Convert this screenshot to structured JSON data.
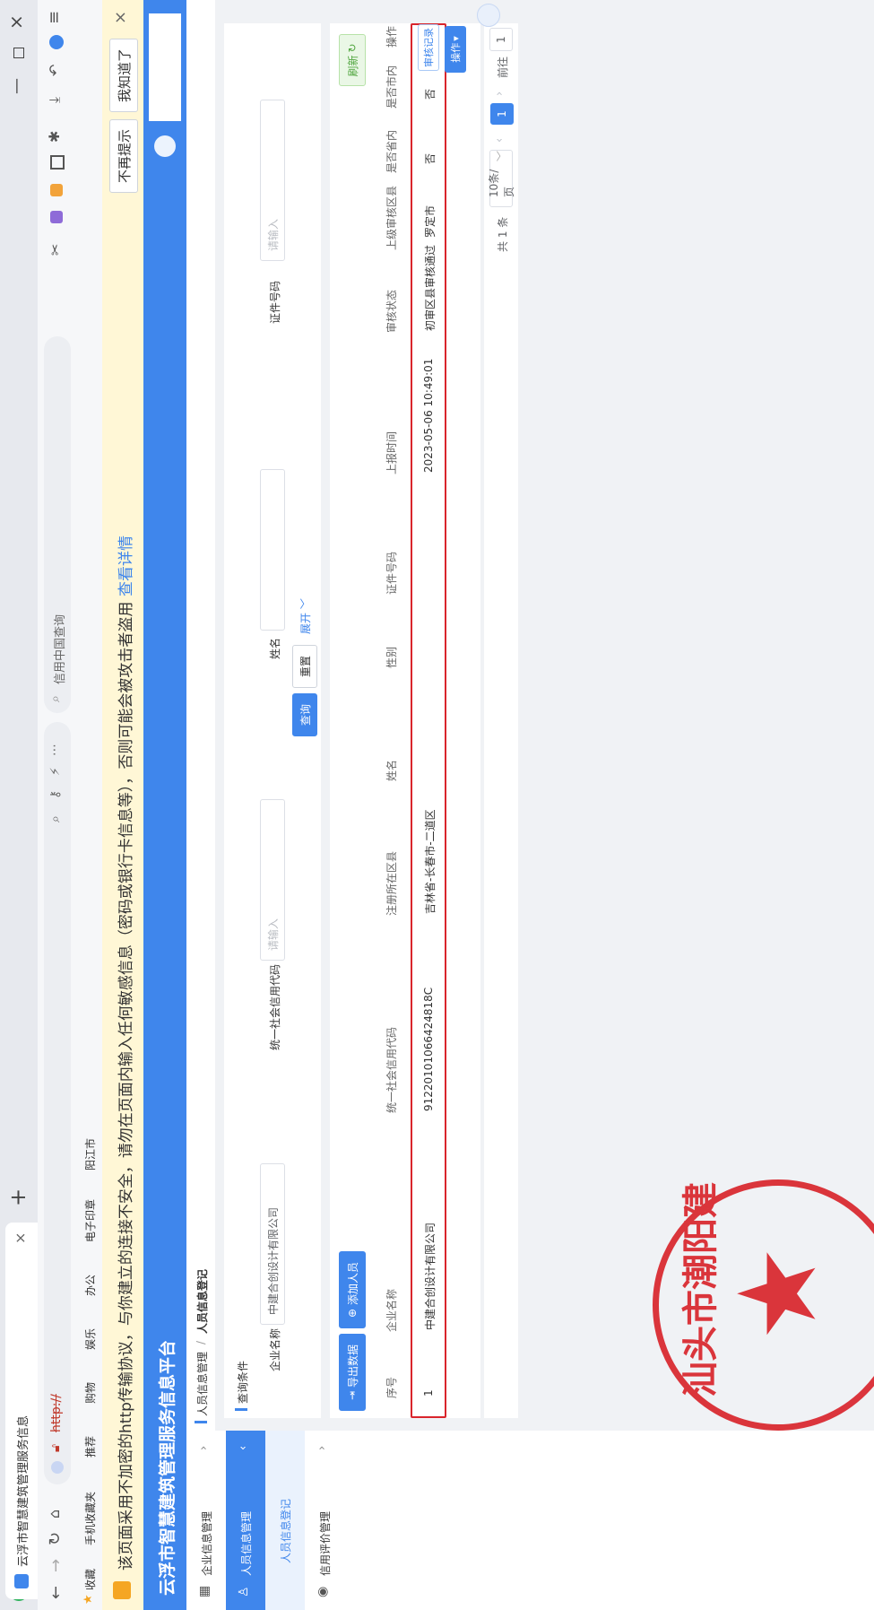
{
  "browser": {
    "tab_title": "云浮市智慧建筑管理服务信息",
    "new_tab_symbol": "+",
    "url": "http://",
    "search_placeholder": "信用中国查询",
    "colors": {
      "warning_bg": "#fff7d6",
      "header_blue": "#3f86ec",
      "seal_red": "#d9252c"
    }
  },
  "bookmarks": [
    "收藏",
    "手机收藏夹",
    "推荐",
    "购物",
    "娱乐",
    "办公",
    "电子印章",
    "阳江市"
  ],
  "warning": {
    "message": "该页面采用不加密的http传输协议，与你建立的连接不安全，请勿在页面内输入任何敏感信息（密码或银行卡信息等），否则可能会被攻击者盗用",
    "details_link": "查看详情",
    "dismiss_button": "不再提示",
    "ok_button": "我知道了",
    "close_symbol": "×"
  },
  "app": {
    "title": "云浮市智慧建筑管理服务信息平台"
  },
  "sidebar": {
    "items": [
      {
        "label": "企业信息管理"
      },
      {
        "label": "人员信息管理"
      },
      {
        "label": "人员信息登记"
      },
      {
        "label": "信用评价管理"
      }
    ]
  },
  "breadcrumb": {
    "parent": "人员信息管理",
    "separator": "/",
    "current": "人员信息登记"
  },
  "query": {
    "section_title": "查询条件",
    "company_label": "企业名称",
    "company_value": "中建合创设计有限公司",
    "uscc_label": "统一社会信用代码",
    "uscc_placeholder": "请输入",
    "name_label": "姓名",
    "name_value": "",
    "cert_label": "证件号码",
    "cert_placeholder": "请输入",
    "search_button": "查询",
    "reset_button": "重置",
    "expand_link": "展开"
  },
  "toolbar": {
    "export_button": "导出数据",
    "add_button": "添加人员",
    "refresh_button": "刷新"
  },
  "table": {
    "headers": [
      "序号",
      "企业名称",
      "统一社会信用代码",
      "注册所在区县",
      "姓名",
      "性别",
      "证件号码",
      "上报时间",
      "审核状态",
      "上级审核区县",
      "是否省内",
      "是否市内",
      "操作"
    ],
    "rows": [
      {
        "index": "1",
        "company": "中建合创设计有限公司",
        "uscc": "91220101066424818C",
        "district": "吉林省-长春市-二道区",
        "name": "",
        "gender": "",
        "cert": "",
        "report_time": "2023-05-06 10:49:01",
        "status": "初审区县审核通过",
        "upper_district": "罗定市",
        "in_province": "否",
        "in_city": "否",
        "action_record": "审核记录",
        "action_more": "操作"
      }
    ]
  },
  "pagination": {
    "total": "共 1 条",
    "page_size": "10条/页",
    "current_page": "1",
    "goto_label": "前往",
    "goto_value": "1"
  },
  "seal": {
    "text": "汕头市潮阳建"
  }
}
